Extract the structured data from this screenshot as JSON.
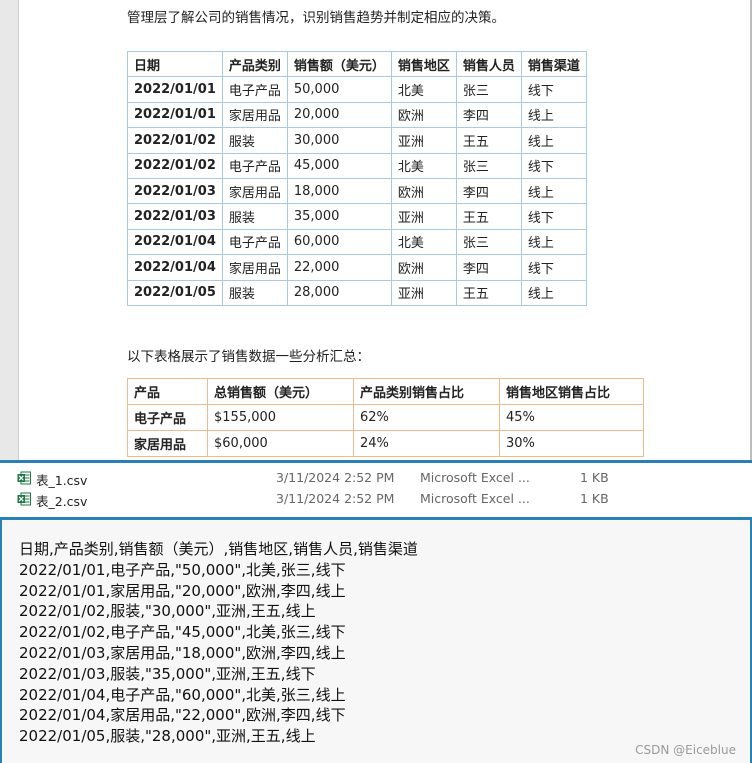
{
  "document": {
    "intro_text": "管理层了解公司的销售情况，识别销售趋势并制定相应的决策。",
    "sales_table": {
      "headers": [
        "日期",
        "产品类别",
        "销售额（美元）",
        "销售地区",
        "销售人员",
        "销售渠道"
      ],
      "rows": [
        [
          "2022/01/01",
          "电子产品",
          "50,000",
          "北美",
          "张三",
          "线下"
        ],
        [
          "2022/01/01",
          "家居用品",
          "20,000",
          "欧洲",
          "李四",
          "线上"
        ],
        [
          "2022/01/02",
          "服装",
          "30,000",
          "亚洲",
          "王五",
          "线上"
        ],
        [
          "2022/01/02",
          "电子产品",
          "45,000",
          "北美",
          "张三",
          "线下"
        ],
        [
          "2022/01/03",
          "家居用品",
          "18,000",
          "欧洲",
          "李四",
          "线上"
        ],
        [
          "2022/01/03",
          "服装",
          "35,000",
          "亚洲",
          "王五",
          "线下"
        ],
        [
          "2022/01/04",
          "电子产品",
          "60,000",
          "北美",
          "张三",
          "线上"
        ],
        [
          "2022/01/04",
          "家居用品",
          "22,000",
          "欧洲",
          "李四",
          "线下"
        ],
        [
          "2022/01/05",
          "服装",
          "28,000",
          "亚洲",
          "王五",
          "线上"
        ]
      ]
    },
    "summary_intro": "以下表格展示了销售数据一些分析汇总：",
    "summary_table": {
      "headers": [
        "产品",
        "总销售额（美元）",
        "产品类别销售占比",
        "销售地区销售占比"
      ],
      "rows": [
        [
          "电子产品",
          "$155,000",
          "62%",
          "45%"
        ],
        [
          "家居用品",
          "$60,000",
          "24%",
          "30%"
        ]
      ]
    }
  },
  "files": [
    {
      "name": "表_1.csv",
      "modified": "3/11/2024 2:52 PM",
      "type": "Microsoft Excel ...",
      "size": "1 KB",
      "icon": "excel-icon"
    },
    {
      "name": "表_2.csv",
      "modified": "3/11/2024 2:52 PM",
      "type": "Microsoft Excel ...",
      "size": "1 KB",
      "icon": "excel-icon"
    }
  ],
  "csv_preview": {
    "lines": [
      "日期,产品类别,销售额（美元）,销售地区,销售人员,销售渠道",
      "2022/01/01,电子产品,\"50,000\",北美,张三,线下",
      "2022/01/01,家居用品,\"20,000\",欧洲,李四,线上",
      "2022/01/02,服装,\"30,000\",亚洲,王五,线上",
      "2022/01/02,电子产品,\"45,000\",北美,张三,线下",
      "2022/01/03,家居用品,\"18,000\",欧洲,李四,线上",
      "2022/01/03,服装,\"35,000\",亚洲,王五,线下",
      "2022/01/04,电子产品,\"60,000\",北美,张三,线上",
      "2022/01/04,家居用品,\"22,000\",欧洲,李四,线下",
      "2022/01/05,服装,\"28,000\",亚洲,王五,线上"
    ]
  },
  "watermark": "CSDN @Eiceblue",
  "colors": {
    "divider": "#2a7fb4",
    "excel_green": "#1d7a44",
    "table1_border": "#a9cbe2",
    "table2_border": "#f2b98c"
  }
}
